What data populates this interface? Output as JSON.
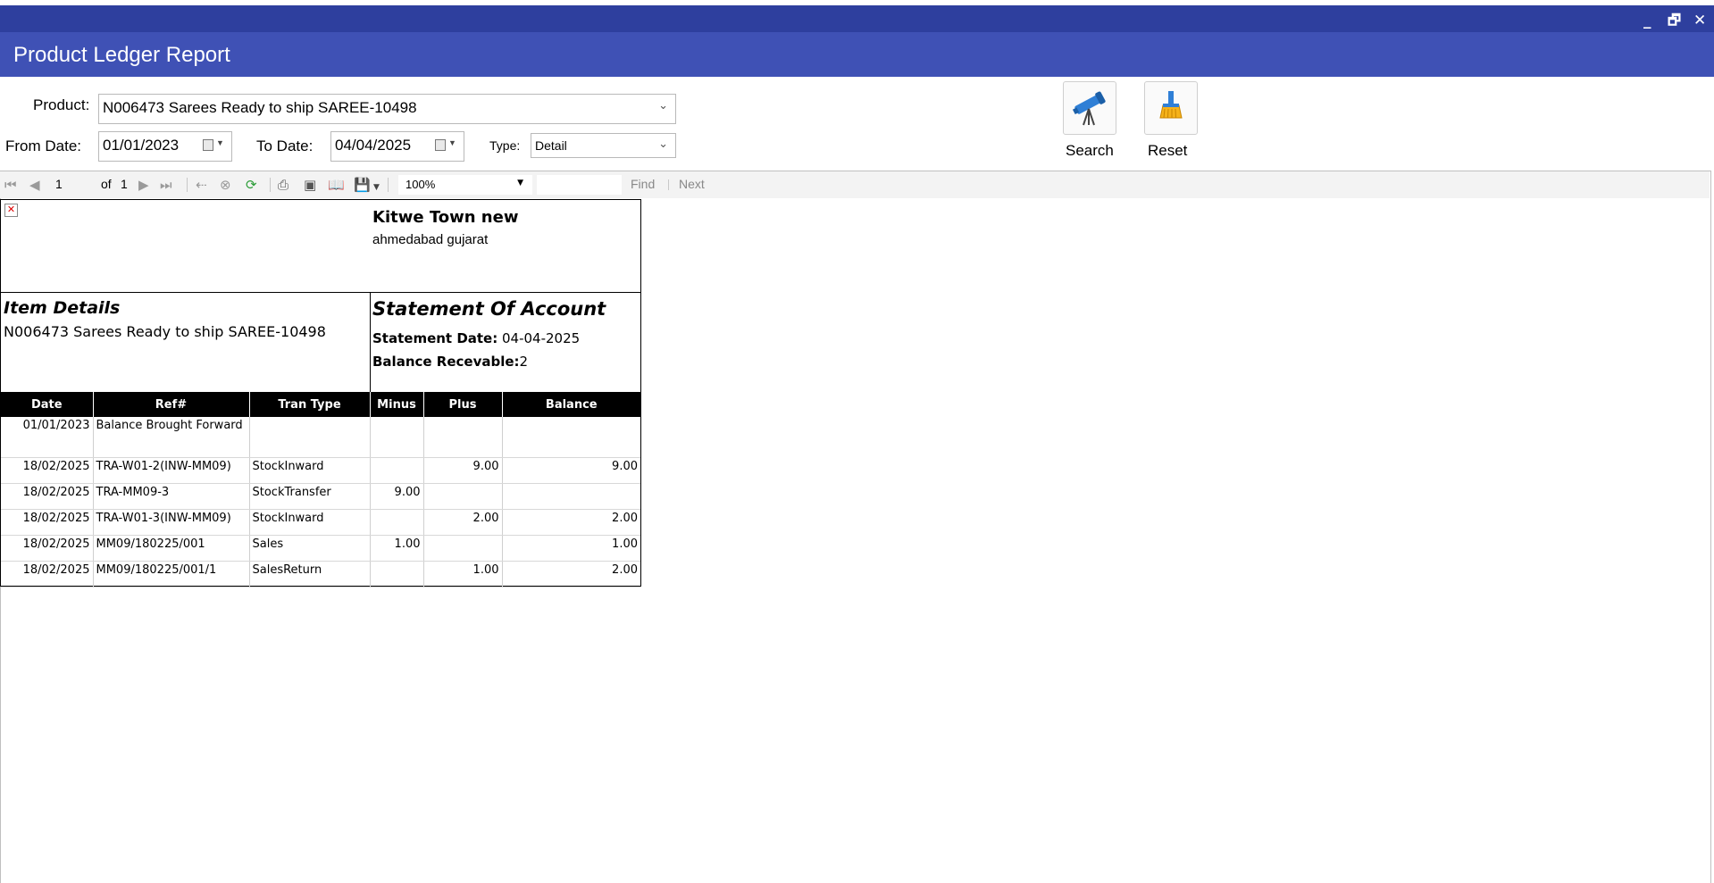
{
  "window": {
    "minimize": "_",
    "restore": "🗗",
    "close": "✕"
  },
  "header": {
    "title": "Product Ledger Report"
  },
  "filters": {
    "product_label": "Product:",
    "product_value": "N006473 Sarees Ready to ship SAREE-10498",
    "from_label": "From Date:",
    "from_value": "01/01/2023",
    "to_label": "To Date:",
    "to_value": "04/04/2025",
    "type_label": "Type:",
    "type_value": "Detail"
  },
  "buttons": {
    "search_label": "Search",
    "reset_label": "Reset"
  },
  "toolbar": {
    "page_value": "1",
    "page_of": "of",
    "page_total": "1",
    "zoom_value": "100%",
    "find_label": "Find",
    "next_label": "Next"
  },
  "report": {
    "company_name": "Kitwe Town new",
    "company_address": "ahmedabad gujarat",
    "item_details_heading": "Item Details",
    "item_name": "N006473 Sarees Ready to ship SAREE-10498",
    "statement_heading": "Statement Of Account",
    "statement_date_label": "Statement Date:",
    "statement_date_value": " 04-04-2025",
    "balance_label": "Balance Recevable:",
    "balance_value": "2",
    "columns": [
      "Date",
      "Ref#",
      "Tran Type",
      "Minus",
      "Plus",
      "Balance"
    ],
    "rows": [
      {
        "date": "01/01/2023",
        "ref": "Balance Brought Forward",
        "type": "",
        "minus": "",
        "plus": "",
        "balance": ""
      },
      {
        "date": "18/02/2025",
        "ref": "TRA-W01-2(INW-MM09)",
        "type": "StockInward",
        "minus": "",
        "plus": "9.00",
        "balance": "9.00"
      },
      {
        "date": "18/02/2025",
        "ref": "TRA-MM09-3",
        "type": "StockTransfer",
        "minus": "9.00",
        "plus": "",
        "balance": ""
      },
      {
        "date": "18/02/2025",
        "ref": "TRA-W01-3(INW-MM09)",
        "type": "StockInward",
        "minus": "",
        "plus": "2.00",
        "balance": "2.00"
      },
      {
        "date": "18/02/2025",
        "ref": "MM09/180225/001",
        "type": "Sales",
        "minus": "1.00",
        "plus": "",
        "balance": "1.00"
      },
      {
        "date": "18/02/2025",
        "ref": "MM09/180225/001/1",
        "type": "SalesReturn",
        "minus": "",
        "plus": "1.00",
        "balance": "2.00"
      }
    ]
  }
}
